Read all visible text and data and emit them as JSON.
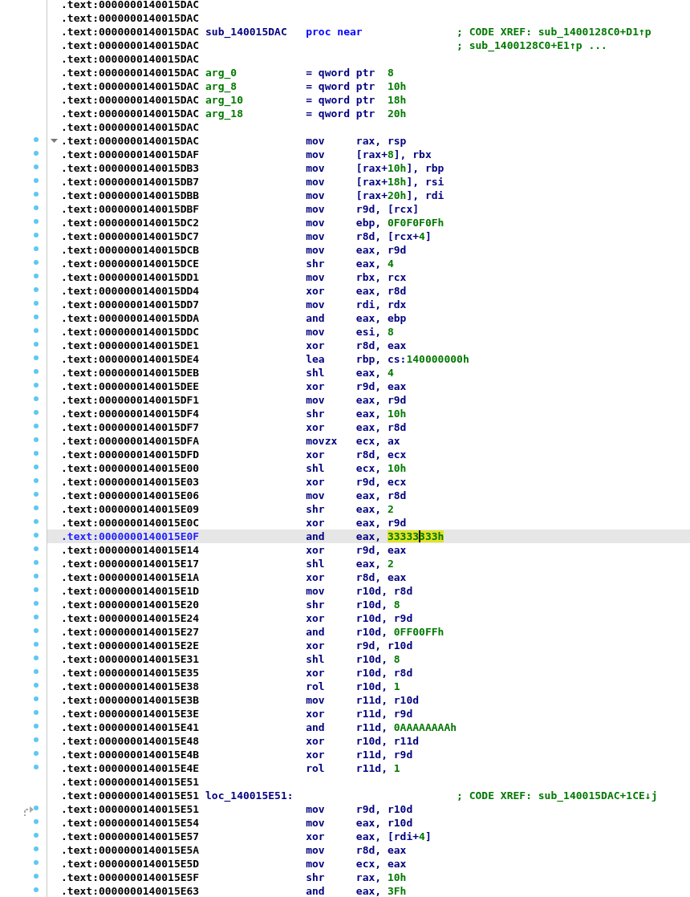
{
  "listing": [
    {
      "addr": ".text:0000000140015DAC",
      "marker": false,
      "selected": false
    },
    {
      "addr": ".text:0000000140015DAC",
      "marker": false,
      "selected": false
    },
    {
      "addr": ".text:0000000140015DAC",
      "label": {
        "text": "sub_140015DAC",
        "kind": "sub"
      },
      "op": {
        "text": "proc near",
        "kind": "keyword"
      },
      "comment": "; CODE XREF: sub_1400128C0+D1↑p",
      "marker": false,
      "selected": false
    },
    {
      "addr": ".text:0000000140015DAC",
      "comment": "; sub_1400128C0+E1↑p ...",
      "marker": false,
      "selected": false
    },
    {
      "addr": ".text:0000000140015DAC",
      "marker": false,
      "selected": false
    },
    {
      "addr": ".text:0000000140015DAC",
      "label": {
        "text": "arg_0",
        "kind": "arg"
      },
      "op": {
        "text": "= qword ptr",
        "kind": "decl"
      },
      "ops": [
        {
          "text": "8",
          "kind": "num"
        }
      ],
      "marker": false,
      "selected": false
    },
    {
      "addr": ".text:0000000140015DAC",
      "label": {
        "text": "arg_8",
        "kind": "arg"
      },
      "op": {
        "text": "= qword ptr",
        "kind": "decl"
      },
      "ops": [
        {
          "text": "10h",
          "kind": "num"
        }
      ],
      "marker": false,
      "selected": false
    },
    {
      "addr": ".text:0000000140015DAC",
      "label": {
        "text": "arg_10",
        "kind": "arg"
      },
      "op": {
        "text": "= qword ptr",
        "kind": "decl"
      },
      "ops": [
        {
          "text": "18h",
          "kind": "num"
        }
      ],
      "marker": false,
      "selected": false
    },
    {
      "addr": ".text:0000000140015DAC",
      "label": {
        "text": "arg_18",
        "kind": "arg"
      },
      "op": {
        "text": "= qword ptr",
        "kind": "decl"
      },
      "ops": [
        {
          "text": "20h",
          "kind": "num"
        }
      ],
      "marker": false,
      "selected": false
    },
    {
      "addr": ".text:0000000140015DAC",
      "marker": false,
      "selected": false
    },
    {
      "addr": ".text:0000000140015DAC",
      "op": {
        "text": "mov",
        "kind": "insn"
      },
      "ops": [
        {
          "text": "rax, rsp",
          "kind": "reg"
        }
      ],
      "marker": true,
      "selected": false,
      "expanded": true
    },
    {
      "addr": ".text:0000000140015DAF",
      "op": {
        "text": "mov",
        "kind": "insn"
      },
      "ops": [
        {
          "text": "[rax+",
          "kind": "reg"
        },
        {
          "text": "8",
          "kind": "num"
        },
        {
          "text": "], rbx",
          "kind": "reg"
        }
      ],
      "marker": true,
      "selected": false
    },
    {
      "addr": ".text:0000000140015DB3",
      "op": {
        "text": "mov",
        "kind": "insn"
      },
      "ops": [
        {
          "text": "[rax+",
          "kind": "reg"
        },
        {
          "text": "10h",
          "kind": "num"
        },
        {
          "text": "], rbp",
          "kind": "reg"
        }
      ],
      "marker": true,
      "selected": false
    },
    {
      "addr": ".text:0000000140015DB7",
      "op": {
        "text": "mov",
        "kind": "insn"
      },
      "ops": [
        {
          "text": "[rax+",
          "kind": "reg"
        },
        {
          "text": "18h",
          "kind": "num"
        },
        {
          "text": "], rsi",
          "kind": "reg"
        }
      ],
      "marker": true,
      "selected": false
    },
    {
      "addr": ".text:0000000140015DBB",
      "op": {
        "text": "mov",
        "kind": "insn"
      },
      "ops": [
        {
          "text": "[rax+",
          "kind": "reg"
        },
        {
          "text": "20h",
          "kind": "num"
        },
        {
          "text": "], rdi",
          "kind": "reg"
        }
      ],
      "marker": true,
      "selected": false
    },
    {
      "addr": ".text:0000000140015DBF",
      "op": {
        "text": "mov",
        "kind": "insn"
      },
      "ops": [
        {
          "text": "r9d, [rcx]",
          "kind": "reg"
        }
      ],
      "marker": true,
      "selected": false
    },
    {
      "addr": ".text:0000000140015DC2",
      "op": {
        "text": "mov",
        "kind": "insn"
      },
      "ops": [
        {
          "text": "ebp, ",
          "kind": "reg"
        },
        {
          "text": "0F0F0F0Fh",
          "kind": "num"
        }
      ],
      "marker": true,
      "selected": false
    },
    {
      "addr": ".text:0000000140015DC7",
      "op": {
        "text": "mov",
        "kind": "insn"
      },
      "ops": [
        {
          "text": "r8d, [rcx+",
          "kind": "reg"
        },
        {
          "text": "4",
          "kind": "num"
        },
        {
          "text": "]",
          "kind": "reg"
        }
      ],
      "marker": true,
      "selected": false
    },
    {
      "addr": ".text:0000000140015DCB",
      "op": {
        "text": "mov",
        "kind": "insn"
      },
      "ops": [
        {
          "text": "eax, r9d",
          "kind": "reg"
        }
      ],
      "marker": true,
      "selected": false
    },
    {
      "addr": ".text:0000000140015DCE",
      "op": {
        "text": "shr",
        "kind": "insn"
      },
      "ops": [
        {
          "text": "eax, ",
          "kind": "reg"
        },
        {
          "text": "4",
          "kind": "num"
        }
      ],
      "marker": true,
      "selected": false
    },
    {
      "addr": ".text:0000000140015DD1",
      "op": {
        "text": "mov",
        "kind": "insn"
      },
      "ops": [
        {
          "text": "rbx, rcx",
          "kind": "reg"
        }
      ],
      "marker": true,
      "selected": false
    },
    {
      "addr": ".text:0000000140015DD4",
      "op": {
        "text": "xor",
        "kind": "insn"
      },
      "ops": [
        {
          "text": "eax, r8d",
          "kind": "reg"
        }
      ],
      "marker": true,
      "selected": false
    },
    {
      "addr": ".text:0000000140015DD7",
      "op": {
        "text": "mov",
        "kind": "insn"
      },
      "ops": [
        {
          "text": "rdi, rdx",
          "kind": "reg"
        }
      ],
      "marker": true,
      "selected": false
    },
    {
      "addr": ".text:0000000140015DDA",
      "op": {
        "text": "and",
        "kind": "insn"
      },
      "ops": [
        {
          "text": "eax, ebp",
          "kind": "reg"
        }
      ],
      "marker": true,
      "selected": false
    },
    {
      "addr": ".text:0000000140015DDC",
      "op": {
        "text": "mov",
        "kind": "insn"
      },
      "ops": [
        {
          "text": "esi, ",
          "kind": "reg"
        },
        {
          "text": "8",
          "kind": "num"
        }
      ],
      "marker": true,
      "selected": false
    },
    {
      "addr": ".text:0000000140015DE1",
      "op": {
        "text": "xor",
        "kind": "insn"
      },
      "ops": [
        {
          "text": "r8d, eax",
          "kind": "reg"
        }
      ],
      "marker": true,
      "selected": false
    },
    {
      "addr": ".text:0000000140015DE4",
      "op": {
        "text": "lea",
        "kind": "insn"
      },
      "ops": [
        {
          "text": "rbp, cs:",
          "kind": "reg"
        },
        {
          "text": "140000000h",
          "kind": "num"
        }
      ],
      "marker": true,
      "selected": false
    },
    {
      "addr": ".text:0000000140015DEB",
      "op": {
        "text": "shl",
        "kind": "insn"
      },
      "ops": [
        {
          "text": "eax, ",
          "kind": "reg"
        },
        {
          "text": "4",
          "kind": "num"
        }
      ],
      "marker": true,
      "selected": false
    },
    {
      "addr": ".text:0000000140015DEE",
      "op": {
        "text": "xor",
        "kind": "insn"
      },
      "ops": [
        {
          "text": "r9d, eax",
          "kind": "reg"
        }
      ],
      "marker": true,
      "selected": false
    },
    {
      "addr": ".text:0000000140015DF1",
      "op": {
        "text": "mov",
        "kind": "insn"
      },
      "ops": [
        {
          "text": "eax, r9d",
          "kind": "reg"
        }
      ],
      "marker": true,
      "selected": false
    },
    {
      "addr": ".text:0000000140015DF4",
      "op": {
        "text": "shr",
        "kind": "insn"
      },
      "ops": [
        {
          "text": "eax, ",
          "kind": "reg"
        },
        {
          "text": "10h",
          "kind": "num"
        }
      ],
      "marker": true,
      "selected": false
    },
    {
      "addr": ".text:0000000140015DF7",
      "op": {
        "text": "xor",
        "kind": "insn"
      },
      "ops": [
        {
          "text": "eax, r8d",
          "kind": "reg"
        }
      ],
      "marker": true,
      "selected": false
    },
    {
      "addr": ".text:0000000140015DFA",
      "op": {
        "text": "movzx",
        "kind": "insn"
      },
      "ops": [
        {
          "text": "ecx, ax",
          "kind": "reg"
        }
      ],
      "marker": true,
      "selected": false
    },
    {
      "addr": ".text:0000000140015DFD",
      "op": {
        "text": "xor",
        "kind": "insn"
      },
      "ops": [
        {
          "text": "r8d, ecx",
          "kind": "reg"
        }
      ],
      "marker": true,
      "selected": false
    },
    {
      "addr": ".text:0000000140015E00",
      "op": {
        "text": "shl",
        "kind": "insn"
      },
      "ops": [
        {
          "text": "ecx, ",
          "kind": "reg"
        },
        {
          "text": "10h",
          "kind": "num"
        }
      ],
      "marker": true,
      "selected": false
    },
    {
      "addr": ".text:0000000140015E03",
      "op": {
        "text": "xor",
        "kind": "insn"
      },
      "ops": [
        {
          "text": "r9d, ecx",
          "kind": "reg"
        }
      ],
      "marker": true,
      "selected": false
    },
    {
      "addr": ".text:0000000140015E06",
      "op": {
        "text": "mov",
        "kind": "insn"
      },
      "ops": [
        {
          "text": "eax, r8d",
          "kind": "reg"
        }
      ],
      "marker": true,
      "selected": false
    },
    {
      "addr": ".text:0000000140015E09",
      "op": {
        "text": "shr",
        "kind": "insn"
      },
      "ops": [
        {
          "text": "eax, ",
          "kind": "reg"
        },
        {
          "text": "2",
          "kind": "num"
        }
      ],
      "marker": true,
      "selected": false
    },
    {
      "addr": ".text:0000000140015E0C",
      "op": {
        "text": "xor",
        "kind": "insn"
      },
      "ops": [
        {
          "text": "eax, r9d",
          "kind": "reg"
        }
      ],
      "marker": true,
      "selected": false
    },
    {
      "addr": ".text:0000000140015E0F",
      "op": {
        "text": "and",
        "kind": "insn"
      },
      "ops": [
        {
          "text": "eax, ",
          "kind": "reg"
        },
        {
          "text": "33333",
          "kind": "hl"
        },
        {
          "text": "333h",
          "kind": "hl",
          "cursor": true
        }
      ],
      "marker": true,
      "selected": true
    },
    {
      "addr": ".text:0000000140015E14",
      "op": {
        "text": "xor",
        "kind": "insn"
      },
      "ops": [
        {
          "text": "r9d, eax",
          "kind": "reg"
        }
      ],
      "marker": true,
      "selected": false
    },
    {
      "addr": ".text:0000000140015E17",
      "op": {
        "text": "shl",
        "kind": "insn"
      },
      "ops": [
        {
          "text": "eax, ",
          "kind": "reg"
        },
        {
          "text": "2",
          "kind": "num"
        }
      ],
      "marker": true,
      "selected": false
    },
    {
      "addr": ".text:0000000140015E1A",
      "op": {
        "text": "xor",
        "kind": "insn"
      },
      "ops": [
        {
          "text": "r8d, eax",
          "kind": "reg"
        }
      ],
      "marker": true,
      "selected": false
    },
    {
      "addr": ".text:0000000140015E1D",
      "op": {
        "text": "mov",
        "kind": "insn"
      },
      "ops": [
        {
          "text": "r10d, r8d",
          "kind": "reg"
        }
      ],
      "marker": true,
      "selected": false
    },
    {
      "addr": ".text:0000000140015E20",
      "op": {
        "text": "shr",
        "kind": "insn"
      },
      "ops": [
        {
          "text": "r10d, ",
          "kind": "reg"
        },
        {
          "text": "8",
          "kind": "num"
        }
      ],
      "marker": true,
      "selected": false
    },
    {
      "addr": ".text:0000000140015E24",
      "op": {
        "text": "xor",
        "kind": "insn"
      },
      "ops": [
        {
          "text": "r10d, r9d",
          "kind": "reg"
        }
      ],
      "marker": true,
      "selected": false
    },
    {
      "addr": ".text:0000000140015E27",
      "op": {
        "text": "and",
        "kind": "insn"
      },
      "ops": [
        {
          "text": "r10d, ",
          "kind": "reg"
        },
        {
          "text": "0FF00FFh",
          "kind": "num"
        }
      ],
      "marker": true,
      "selected": false
    },
    {
      "addr": ".text:0000000140015E2E",
      "op": {
        "text": "xor",
        "kind": "insn"
      },
      "ops": [
        {
          "text": "r9d, r10d",
          "kind": "reg"
        }
      ],
      "marker": true,
      "selected": false
    },
    {
      "addr": ".text:0000000140015E31",
      "op": {
        "text": "shl",
        "kind": "insn"
      },
      "ops": [
        {
          "text": "r10d, ",
          "kind": "reg"
        },
        {
          "text": "8",
          "kind": "num"
        }
      ],
      "marker": true,
      "selected": false
    },
    {
      "addr": ".text:0000000140015E35",
      "op": {
        "text": "xor",
        "kind": "insn"
      },
      "ops": [
        {
          "text": "r10d, r8d",
          "kind": "reg"
        }
      ],
      "marker": true,
      "selected": false
    },
    {
      "addr": ".text:0000000140015E38",
      "op": {
        "text": "rol",
        "kind": "insn"
      },
      "ops": [
        {
          "text": "r10d, ",
          "kind": "reg"
        },
        {
          "text": "1",
          "kind": "num"
        }
      ],
      "marker": true,
      "selected": false
    },
    {
      "addr": ".text:0000000140015E3B",
      "op": {
        "text": "mov",
        "kind": "insn"
      },
      "ops": [
        {
          "text": "r11d, r10d",
          "kind": "reg"
        }
      ],
      "marker": true,
      "selected": false
    },
    {
      "addr": ".text:0000000140015E3E",
      "op": {
        "text": "xor",
        "kind": "insn"
      },
      "ops": [
        {
          "text": "r11d, r9d",
          "kind": "reg"
        }
      ],
      "marker": true,
      "selected": false
    },
    {
      "addr": ".text:0000000140015E41",
      "op": {
        "text": "and",
        "kind": "insn"
      },
      "ops": [
        {
          "text": "r11d, ",
          "kind": "reg"
        },
        {
          "text": "0AAAAAAAAh",
          "kind": "num"
        }
      ],
      "marker": true,
      "selected": false
    },
    {
      "addr": ".text:0000000140015E48",
      "op": {
        "text": "xor",
        "kind": "insn"
      },
      "ops": [
        {
          "text": "r10d, r11d",
          "kind": "reg"
        }
      ],
      "marker": true,
      "selected": false
    },
    {
      "addr": ".text:0000000140015E4B",
      "op": {
        "text": "xor",
        "kind": "insn"
      },
      "ops": [
        {
          "text": "r11d, r9d",
          "kind": "reg"
        }
      ],
      "marker": true,
      "selected": false
    },
    {
      "addr": ".text:0000000140015E4E",
      "op": {
        "text": "rol",
        "kind": "insn"
      },
      "ops": [
        {
          "text": "r11d, ",
          "kind": "reg"
        },
        {
          "text": "1",
          "kind": "num"
        }
      ],
      "marker": true,
      "selected": false
    },
    {
      "addr": ".text:0000000140015E51",
      "marker": false,
      "selected": false
    },
    {
      "addr": ".text:0000000140015E51",
      "label": {
        "text": "loc_140015E51:",
        "kind": "loc"
      },
      "comment": "; CODE XREF: sub_140015DAC+1CE↓j",
      "marker": false,
      "selected": false
    },
    {
      "addr": ".text:0000000140015E51",
      "op": {
        "text": "mov",
        "kind": "insn"
      },
      "ops": [
        {
          "text": "r9d, r10d",
          "kind": "reg"
        }
      ],
      "marker": true,
      "selected": false,
      "jump_in": true
    },
    {
      "addr": ".text:0000000140015E54",
      "op": {
        "text": "mov",
        "kind": "insn"
      },
      "ops": [
        {
          "text": "eax, r10d",
          "kind": "reg"
        }
      ],
      "marker": true,
      "selected": false
    },
    {
      "addr": ".text:0000000140015E57",
      "op": {
        "text": "xor",
        "kind": "insn"
      },
      "ops": [
        {
          "text": "eax, [rdi+",
          "kind": "reg"
        },
        {
          "text": "4",
          "kind": "num"
        },
        {
          "text": "]",
          "kind": "reg"
        }
      ],
      "marker": true,
      "selected": false
    },
    {
      "addr": ".text:0000000140015E5A",
      "op": {
        "text": "mov",
        "kind": "insn"
      },
      "ops": [
        {
          "text": "r8d, eax",
          "kind": "reg"
        }
      ],
      "marker": true,
      "selected": false
    },
    {
      "addr": ".text:0000000140015E5D",
      "op": {
        "text": "mov",
        "kind": "insn"
      },
      "ops": [
        {
          "text": "ecx, eax",
          "kind": "reg"
        }
      ],
      "marker": true,
      "selected": false
    },
    {
      "addr": ".text:0000000140015E5F",
      "op": {
        "text": "shr",
        "kind": "insn"
      },
      "ops": [
        {
          "text": "rax, ",
          "kind": "reg"
        },
        {
          "text": "10h",
          "kind": "num"
        }
      ],
      "marker": true,
      "selected": false
    },
    {
      "addr": ".text:0000000140015E63",
      "op": {
        "text": "and",
        "kind": "insn"
      },
      "ops": [
        {
          "text": "eax, ",
          "kind": "reg"
        },
        {
          "text": "3Fh",
          "kind": "num"
        }
      ],
      "marker": true,
      "selected": false
    }
  ]
}
